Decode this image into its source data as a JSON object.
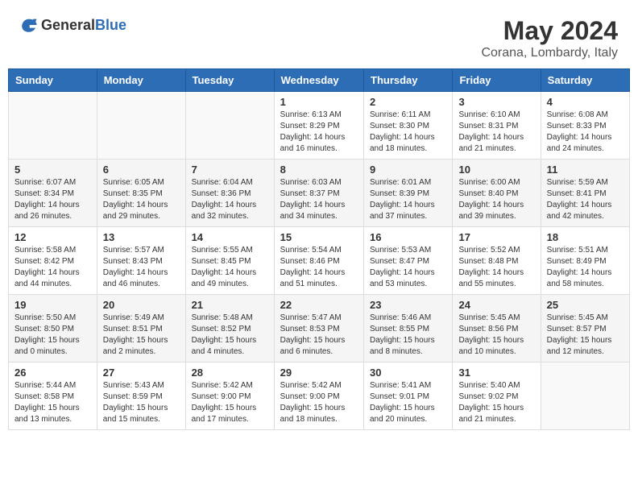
{
  "header": {
    "logo_general": "General",
    "logo_blue": "Blue",
    "month_title": "May 2024",
    "location": "Corana, Lombardy, Italy"
  },
  "weekdays": [
    "Sunday",
    "Monday",
    "Tuesday",
    "Wednesday",
    "Thursday",
    "Friday",
    "Saturday"
  ],
  "weeks": [
    [
      {
        "day": "",
        "sunrise": "",
        "sunset": "",
        "daylight": ""
      },
      {
        "day": "",
        "sunrise": "",
        "sunset": "",
        "daylight": ""
      },
      {
        "day": "",
        "sunrise": "",
        "sunset": "",
        "daylight": ""
      },
      {
        "day": "1",
        "sunrise": "Sunrise: 6:13 AM",
        "sunset": "Sunset: 8:29 PM",
        "daylight": "Daylight: 14 hours and 16 minutes."
      },
      {
        "day": "2",
        "sunrise": "Sunrise: 6:11 AM",
        "sunset": "Sunset: 8:30 PM",
        "daylight": "Daylight: 14 hours and 18 minutes."
      },
      {
        "day": "3",
        "sunrise": "Sunrise: 6:10 AM",
        "sunset": "Sunset: 8:31 PM",
        "daylight": "Daylight: 14 hours and 21 minutes."
      },
      {
        "day": "4",
        "sunrise": "Sunrise: 6:08 AM",
        "sunset": "Sunset: 8:33 PM",
        "daylight": "Daylight: 14 hours and 24 minutes."
      }
    ],
    [
      {
        "day": "5",
        "sunrise": "Sunrise: 6:07 AM",
        "sunset": "Sunset: 8:34 PM",
        "daylight": "Daylight: 14 hours and 26 minutes."
      },
      {
        "day": "6",
        "sunrise": "Sunrise: 6:05 AM",
        "sunset": "Sunset: 8:35 PM",
        "daylight": "Daylight: 14 hours and 29 minutes."
      },
      {
        "day": "7",
        "sunrise": "Sunrise: 6:04 AM",
        "sunset": "Sunset: 8:36 PM",
        "daylight": "Daylight: 14 hours and 32 minutes."
      },
      {
        "day": "8",
        "sunrise": "Sunrise: 6:03 AM",
        "sunset": "Sunset: 8:37 PM",
        "daylight": "Daylight: 14 hours and 34 minutes."
      },
      {
        "day": "9",
        "sunrise": "Sunrise: 6:01 AM",
        "sunset": "Sunset: 8:39 PM",
        "daylight": "Daylight: 14 hours and 37 minutes."
      },
      {
        "day": "10",
        "sunrise": "Sunrise: 6:00 AM",
        "sunset": "Sunset: 8:40 PM",
        "daylight": "Daylight: 14 hours and 39 minutes."
      },
      {
        "day": "11",
        "sunrise": "Sunrise: 5:59 AM",
        "sunset": "Sunset: 8:41 PM",
        "daylight": "Daylight: 14 hours and 42 minutes."
      }
    ],
    [
      {
        "day": "12",
        "sunrise": "Sunrise: 5:58 AM",
        "sunset": "Sunset: 8:42 PM",
        "daylight": "Daylight: 14 hours and 44 minutes."
      },
      {
        "day": "13",
        "sunrise": "Sunrise: 5:57 AM",
        "sunset": "Sunset: 8:43 PM",
        "daylight": "Daylight: 14 hours and 46 minutes."
      },
      {
        "day": "14",
        "sunrise": "Sunrise: 5:55 AM",
        "sunset": "Sunset: 8:45 PM",
        "daylight": "Daylight: 14 hours and 49 minutes."
      },
      {
        "day": "15",
        "sunrise": "Sunrise: 5:54 AM",
        "sunset": "Sunset: 8:46 PM",
        "daylight": "Daylight: 14 hours and 51 minutes."
      },
      {
        "day": "16",
        "sunrise": "Sunrise: 5:53 AM",
        "sunset": "Sunset: 8:47 PM",
        "daylight": "Daylight: 14 hours and 53 minutes."
      },
      {
        "day": "17",
        "sunrise": "Sunrise: 5:52 AM",
        "sunset": "Sunset: 8:48 PM",
        "daylight": "Daylight: 14 hours and 55 minutes."
      },
      {
        "day": "18",
        "sunrise": "Sunrise: 5:51 AM",
        "sunset": "Sunset: 8:49 PM",
        "daylight": "Daylight: 14 hours and 58 minutes."
      }
    ],
    [
      {
        "day": "19",
        "sunrise": "Sunrise: 5:50 AM",
        "sunset": "Sunset: 8:50 PM",
        "daylight": "Daylight: 15 hours and 0 minutes."
      },
      {
        "day": "20",
        "sunrise": "Sunrise: 5:49 AM",
        "sunset": "Sunset: 8:51 PM",
        "daylight": "Daylight: 15 hours and 2 minutes."
      },
      {
        "day": "21",
        "sunrise": "Sunrise: 5:48 AM",
        "sunset": "Sunset: 8:52 PM",
        "daylight": "Daylight: 15 hours and 4 minutes."
      },
      {
        "day": "22",
        "sunrise": "Sunrise: 5:47 AM",
        "sunset": "Sunset: 8:53 PM",
        "daylight": "Daylight: 15 hours and 6 minutes."
      },
      {
        "day": "23",
        "sunrise": "Sunrise: 5:46 AM",
        "sunset": "Sunset: 8:55 PM",
        "daylight": "Daylight: 15 hours and 8 minutes."
      },
      {
        "day": "24",
        "sunrise": "Sunrise: 5:45 AM",
        "sunset": "Sunset: 8:56 PM",
        "daylight": "Daylight: 15 hours and 10 minutes."
      },
      {
        "day": "25",
        "sunrise": "Sunrise: 5:45 AM",
        "sunset": "Sunset: 8:57 PM",
        "daylight": "Daylight: 15 hours and 12 minutes."
      }
    ],
    [
      {
        "day": "26",
        "sunrise": "Sunrise: 5:44 AM",
        "sunset": "Sunset: 8:58 PM",
        "daylight": "Daylight: 15 hours and 13 minutes."
      },
      {
        "day": "27",
        "sunrise": "Sunrise: 5:43 AM",
        "sunset": "Sunset: 8:59 PM",
        "daylight": "Daylight: 15 hours and 15 minutes."
      },
      {
        "day": "28",
        "sunrise": "Sunrise: 5:42 AM",
        "sunset": "Sunset: 9:00 PM",
        "daylight": "Daylight: 15 hours and 17 minutes."
      },
      {
        "day": "29",
        "sunrise": "Sunrise: 5:42 AM",
        "sunset": "Sunset: 9:00 PM",
        "daylight": "Daylight: 15 hours and 18 minutes."
      },
      {
        "day": "30",
        "sunrise": "Sunrise: 5:41 AM",
        "sunset": "Sunset: 9:01 PM",
        "daylight": "Daylight: 15 hours and 20 minutes."
      },
      {
        "day": "31",
        "sunrise": "Sunrise: 5:40 AM",
        "sunset": "Sunset: 9:02 PM",
        "daylight": "Daylight: 15 hours and 21 minutes."
      },
      {
        "day": "",
        "sunrise": "",
        "sunset": "",
        "daylight": ""
      }
    ]
  ]
}
